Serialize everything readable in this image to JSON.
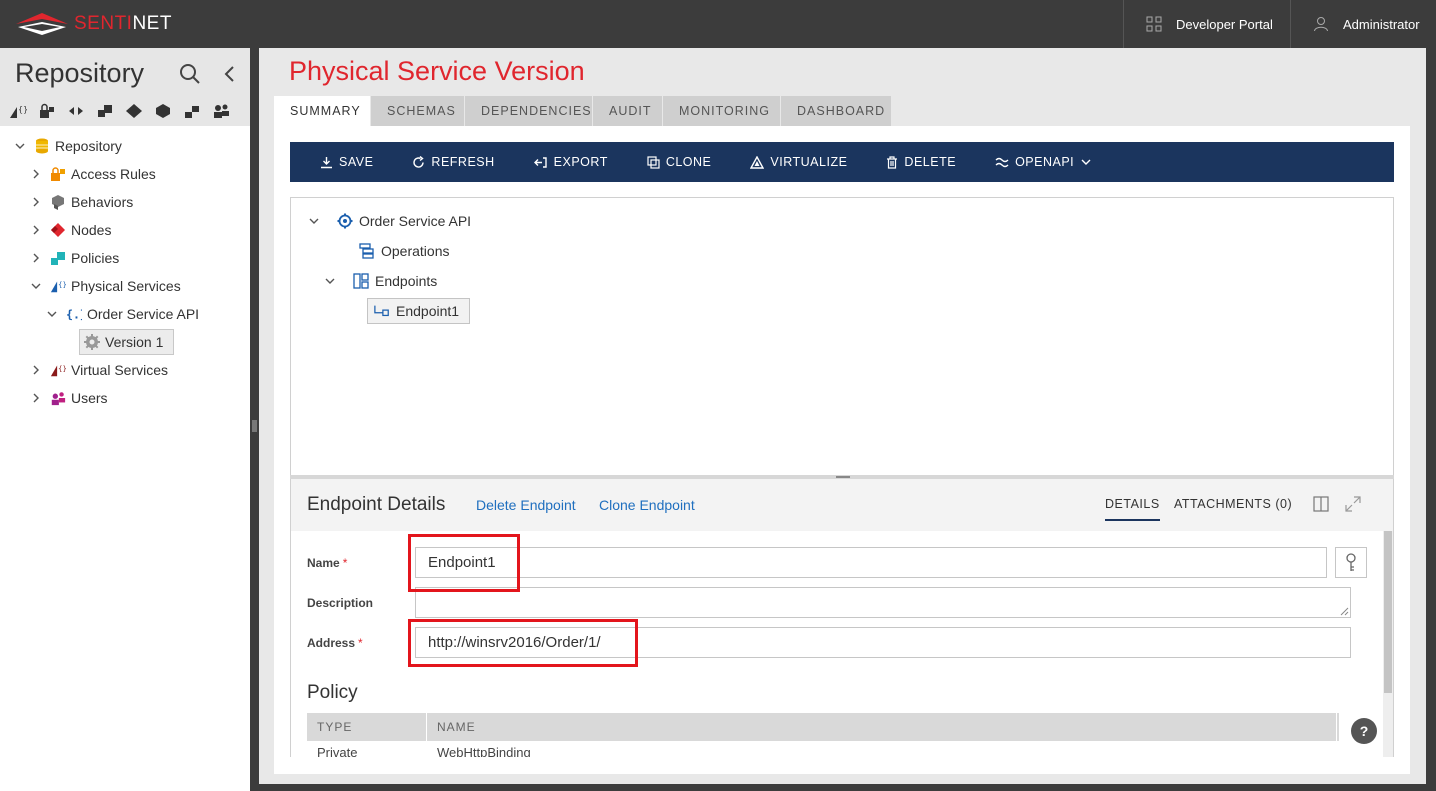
{
  "brand": {
    "logo_part1": "SENTI",
    "logo_part2": "NET"
  },
  "topbar": {
    "developer_portal": "Developer Portal",
    "user": "Administrator"
  },
  "sidebar": {
    "title": "Repository",
    "tree": [
      {
        "label": "Repository"
      },
      {
        "label": "Access Rules"
      },
      {
        "label": "Behaviors"
      },
      {
        "label": "Nodes"
      },
      {
        "label": "Policies"
      },
      {
        "label": "Physical Services"
      },
      {
        "label": "Order Service API"
      },
      {
        "label": "Version 1"
      },
      {
        "label": "Virtual Services"
      },
      {
        "label": "Users"
      }
    ]
  },
  "main": {
    "title": "Physical Service Version",
    "tabs": [
      "SUMMARY",
      "SCHEMAS",
      "DEPENDENCIES",
      "AUDIT",
      "MONITORING",
      "DASHBOARD"
    ],
    "toolbar": [
      "SAVE",
      "REFRESH",
      "EXPORT",
      "CLONE",
      "VIRTUALIZE",
      "DELETE",
      "OPENAPI"
    ],
    "content_tree": [
      {
        "label": "Order Service API"
      },
      {
        "label": "Operations"
      },
      {
        "label": "Endpoints"
      },
      {
        "label": "Endpoint1"
      }
    ]
  },
  "details": {
    "title": "Endpoint Details",
    "links": [
      "Delete Endpoint",
      "Clone Endpoint"
    ],
    "tabs": [
      "DETAILS",
      "ATTACHMENTS (0)"
    ],
    "labels": {
      "name": "Name",
      "description": "Description",
      "address": "Address"
    },
    "required_mark": "*",
    "values": {
      "name": "Endpoint1",
      "description": "",
      "address": "http://winsrv2016/Order/1/"
    },
    "policy_title": "Policy",
    "policy_columns": [
      "TYPE",
      "NAME"
    ],
    "policy_rows": [
      {
        "type": "Private",
        "name": "WebHttpBinding"
      }
    ],
    "help": "?"
  },
  "colors": {
    "brand_red": "#e0262e",
    "toolbar_navy": "#1b355e",
    "highlight_red": "#e3151c",
    "link_blue": "#1f6fbf"
  }
}
